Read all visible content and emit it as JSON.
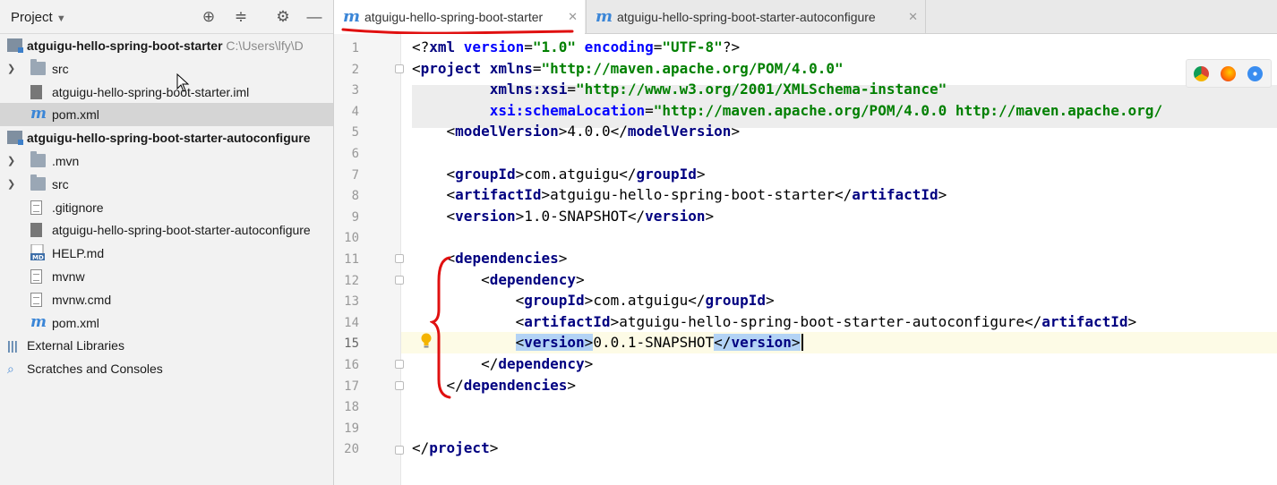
{
  "project_panel": {
    "title": "Project",
    "tree": [
      {
        "label": "atguigu-hello-spring-boot-starter",
        "path": "C:\\Users\\lfy\\D",
        "icon": "module-icon",
        "bold": true
      },
      {
        "label": "src",
        "icon": "folder-icon",
        "expandable": true
      },
      {
        "label": "atguigu-hello-spring-boot-starter.iml",
        "icon": "iml-file-icon"
      },
      {
        "label": "pom.xml",
        "icon": "maven-icon",
        "selected": true
      },
      {
        "label": "atguigu-hello-spring-boot-starter-autoconfigure",
        "icon": "module-icon",
        "bold": true
      },
      {
        "label": ".mvn",
        "icon": "folder-icon",
        "expandable": true
      },
      {
        "label": "src",
        "icon": "folder-icon",
        "expandable": true
      },
      {
        "label": ".gitignore",
        "icon": "text-file-icon"
      },
      {
        "label": "atguigu-hello-spring-boot-starter-autoconfigure",
        "icon": "iml-file-icon"
      },
      {
        "label": "HELP.md",
        "icon": "markdown-file-icon"
      },
      {
        "label": "mvnw",
        "icon": "text-file-icon"
      },
      {
        "label": "mvnw.cmd",
        "icon": "text-file-icon"
      },
      {
        "label": "pom.xml",
        "icon": "maven-icon"
      },
      {
        "label": "External Libraries",
        "icon": "libraries-icon"
      },
      {
        "label": "Scratches and Consoles",
        "icon": "scratches-icon"
      }
    ]
  },
  "tabs": [
    {
      "label": "atguigu-hello-spring-boot-starter",
      "active": true
    },
    {
      "label": "atguigu-hello-spring-boot-starter-autoconfigure",
      "active": false
    }
  ],
  "editor": {
    "lines": [
      [
        [
          "t",
          "<?"
        ],
        [
          "a",
          "xml "
        ],
        [
          "a",
          "version"
        ],
        [
          "t",
          "="
        ],
        [
          "v",
          "\"1.0\""
        ],
        [
          "a",
          " encoding"
        ],
        [
          "t",
          "="
        ],
        [
          "v",
          "\"UTF-8\""
        ],
        [
          "t",
          "?>"
        ]
      ],
      [
        [
          "t",
          "<"
        ],
        [
          "g",
          "project "
        ],
        [
          "a",
          "xmlns"
        ],
        [
          "t",
          "="
        ],
        [
          "v",
          "\"http://maven.apache.org/POM/4.0.0\""
        ]
      ],
      [
        [
          "p",
          "         "
        ],
        [
          "a",
          "xmlns:xsi"
        ],
        [
          "t",
          "="
        ],
        [
          "v",
          "\"http://www.w3.org/2001/XMLSchema-instance\""
        ]
      ],
      [
        [
          "p",
          "         "
        ],
        [
          "a",
          "xsi:schemaLocation"
        ],
        [
          "t",
          "="
        ],
        [
          "v",
          "\"http://maven.apache.org/POM/4.0.0 http://maven.apache.org/"
        ]
      ],
      [
        [
          "p",
          "    "
        ],
        [
          "t",
          "<"
        ],
        [
          "g",
          "modelVersion"
        ],
        [
          "t",
          ">"
        ],
        [
          "p",
          "4.0.0"
        ],
        [
          "t",
          "</"
        ],
        [
          "g",
          "modelVersion"
        ],
        [
          "t",
          ">"
        ]
      ],
      [],
      [
        [
          "p",
          "    "
        ],
        [
          "t",
          "<"
        ],
        [
          "g",
          "groupId"
        ],
        [
          "t",
          ">"
        ],
        [
          "p",
          "com.atguigu"
        ],
        [
          "t",
          "</"
        ],
        [
          "g",
          "groupId"
        ],
        [
          "t",
          ">"
        ]
      ],
      [
        [
          "p",
          "    "
        ],
        [
          "t",
          "<"
        ],
        [
          "g",
          "artifactId"
        ],
        [
          "t",
          ">"
        ],
        [
          "p",
          "atguigu-hello-spring-boot-starter"
        ],
        [
          "t",
          "</"
        ],
        [
          "g",
          "artifactId"
        ],
        [
          "t",
          ">"
        ]
      ],
      [
        [
          "p",
          "    "
        ],
        [
          "t",
          "<"
        ],
        [
          "g",
          "version"
        ],
        [
          "t",
          ">"
        ],
        [
          "p",
          "1.0-SNAPSHOT"
        ],
        [
          "t",
          "</"
        ],
        [
          "g",
          "version"
        ],
        [
          "t",
          ">"
        ]
      ],
      [],
      [
        [
          "p",
          "    "
        ],
        [
          "t",
          "<"
        ],
        [
          "g",
          "dependencies"
        ],
        [
          "t",
          ">"
        ]
      ],
      [
        [
          "p",
          "        "
        ],
        [
          "t",
          "<"
        ],
        [
          "g",
          "dependency"
        ],
        [
          "t",
          ">"
        ]
      ],
      [
        [
          "p",
          "            "
        ],
        [
          "t",
          "<"
        ],
        [
          "g",
          "groupId"
        ],
        [
          "t",
          ">"
        ],
        [
          "p",
          "com.atguigu"
        ],
        [
          "t",
          "</"
        ],
        [
          "g",
          "groupId"
        ],
        [
          "t",
          ">"
        ]
      ],
      [
        [
          "p",
          "            "
        ],
        [
          "t",
          "<"
        ],
        [
          "g",
          "artifactId"
        ],
        [
          "t",
          ">"
        ],
        [
          "p",
          "atguigu-hello-spring-boot-starter-autoconfigure"
        ],
        [
          "t",
          "</"
        ],
        [
          "g",
          "artifactId"
        ],
        [
          "t",
          ">"
        ]
      ],
      [
        [
          "p",
          "            "
        ],
        [
          "h",
          "<"
        ],
        [
          "H",
          "version"
        ],
        [
          "h",
          ">"
        ],
        [
          "p",
          "0.0.1-SNAPSHOT"
        ],
        [
          "h",
          "</"
        ],
        [
          "H",
          "version"
        ],
        [
          "h",
          ">"
        ]
      ],
      [
        [
          "p",
          "        "
        ],
        [
          "t",
          "</"
        ],
        [
          "g",
          "dependency"
        ],
        [
          "t",
          ">"
        ]
      ],
      [
        [
          "p",
          "    "
        ],
        [
          "t",
          "</"
        ],
        [
          "g",
          "dependencies"
        ],
        [
          "t",
          ">"
        ]
      ],
      [],
      [],
      [
        [
          "t",
          "</"
        ],
        [
          "g",
          "project"
        ],
        [
          "t",
          ">"
        ]
      ]
    ],
    "line_numbers": [
      "1",
      "2",
      "3",
      "4",
      "5",
      "6",
      "7",
      "8",
      "9",
      "10",
      "11",
      "12",
      "13",
      "14",
      "15",
      "16",
      "17",
      "18",
      "19",
      "20"
    ],
    "caret_line": "15"
  },
  "colors": {
    "tag": "#000080",
    "attribute": "#0000ff",
    "value": "#008000",
    "annotation_red": "#e01010",
    "selection": "#b3d3f5"
  },
  "browser_icons": [
    "chrome-icon",
    "firefox-icon",
    "safari-icon"
  ]
}
